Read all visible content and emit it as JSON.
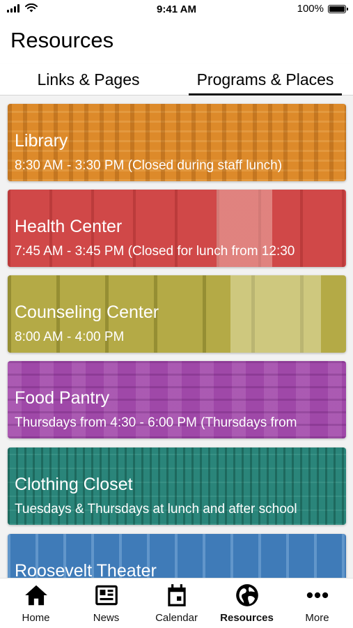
{
  "status_bar": {
    "time": "9:41 AM",
    "battery": "100%"
  },
  "header": {
    "title": "Resources"
  },
  "tabs": [
    {
      "label": "Links & Pages",
      "active": false
    },
    {
      "label": "Programs & Places",
      "active": true
    }
  ],
  "cards": [
    {
      "name": "Library",
      "hours": "8:30 AM - 3:30 PM (Closed during staff lunch)",
      "color": "#dd8a2a"
    },
    {
      "name": "Health Center",
      "hours": "7:45 AM - 3:45 PM (Closed for lunch from 12:30",
      "color": "#d04848"
    },
    {
      "name": "Counseling Center",
      "hours": "8:00 AM - 4:00 PM",
      "color": "#b4aa46"
    },
    {
      "name": "Food Pantry",
      "hours": "Thursdays from 4:30 - 6:00 PM (Thursdays from",
      "color": "#9f48a8"
    },
    {
      "name": "Clothing Closet",
      "hours": "Tuesdays & Thursdays at lunch and after school",
      "color": "#2a857a"
    },
    {
      "name": "Roosevelt Theater",
      "hours": "",
      "color": "#3f7bb8"
    }
  ],
  "nav": [
    {
      "label": "Home",
      "icon": "home-icon"
    },
    {
      "label": "News",
      "icon": "news-icon"
    },
    {
      "label": "Calendar",
      "icon": "calendar-icon"
    },
    {
      "label": "Resources",
      "icon": "globe-icon",
      "active": true
    },
    {
      "label": "More",
      "icon": "more-icon"
    }
  ]
}
